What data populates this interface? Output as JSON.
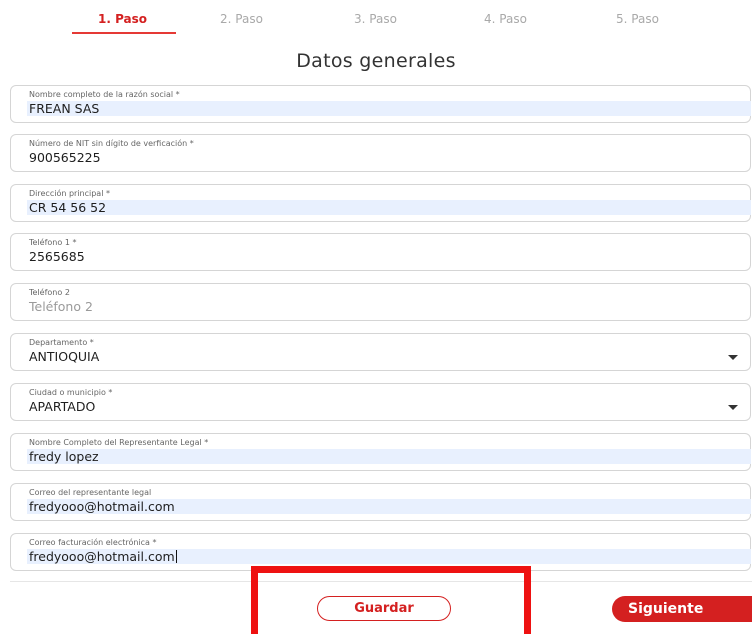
{
  "steps": [
    {
      "label": "1. Paso",
      "active": true
    },
    {
      "label": "2. Paso",
      "active": false
    },
    {
      "label": "3. Paso",
      "active": false
    },
    {
      "label": "4. Paso",
      "active": false
    },
    {
      "label": "5. Paso",
      "active": false
    }
  ],
  "form": {
    "title": "Datos generales",
    "fields": {
      "razon_social": {
        "label": "Nombre completo de la razón social *",
        "value": "FREAN SAS"
      },
      "nit": {
        "label": "Número de NIT sin dígito de verficación *",
        "value": "900565225"
      },
      "direccion": {
        "label": "Dirección principal *",
        "value": "CR 54 56 52"
      },
      "telefono1": {
        "label": "Teléfono 1 *",
        "value": "2565685"
      },
      "telefono2": {
        "label": "Teléfono 2",
        "placeholder": "Teléfono 2"
      },
      "departamento": {
        "label": "Departamento *",
        "value": "ANTIOQUIA"
      },
      "ciudad": {
        "label": "Ciudad o municipio *",
        "value": "APARTADO"
      },
      "representante": {
        "label": "Nombre Completo del Representante Legal *",
        "value": "fredy lopez"
      },
      "correo_representante": {
        "label": "Correo del representante legal",
        "value": "fredyooo@hotmail.com"
      },
      "correo_facturacion": {
        "label": "Correo facturación electrónica *",
        "value": "fredyooo@hotmail.com"
      }
    }
  },
  "actions": {
    "save_label": "Guardar",
    "next_label": "Siguiente"
  },
  "colors": {
    "accent": "#d42020",
    "autofill": "#e8f0fe",
    "highlight": "#ee1111"
  }
}
